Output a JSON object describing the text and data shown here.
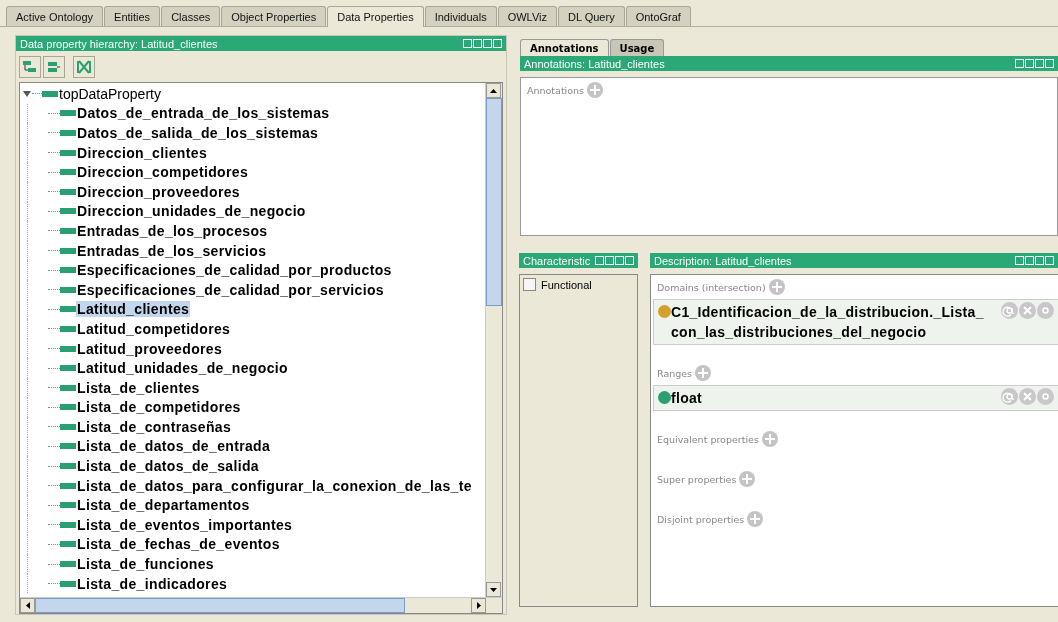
{
  "tabs": [
    {
      "label": "Active Ontology",
      "selected": false
    },
    {
      "label": "Entities",
      "selected": false
    },
    {
      "label": "Classes",
      "selected": false
    },
    {
      "label": "Object Properties",
      "selected": false
    },
    {
      "label": "Data Properties",
      "selected": true
    },
    {
      "label": "Individuals",
      "selected": false
    },
    {
      "label": "OWLViz",
      "selected": false
    },
    {
      "label": "DL Query",
      "selected": false
    },
    {
      "label": "OntoGraf",
      "selected": false
    }
  ],
  "hierarchy": {
    "title": "Data property hierarchy: Latitud_clientes",
    "tree": [
      {
        "label": "topDataProperty",
        "expanded": true,
        "selected": false,
        "children": [
          {
            "label": "Datos_de_entrada_de_los_sistemas",
            "selected": false
          },
          {
            "label": "Datos_de_salida_de_los_sistemas",
            "selected": false
          },
          {
            "label": "Direccion_clientes",
            "selected": false
          },
          {
            "label": "Direccion_competidores",
            "selected": false
          },
          {
            "label": "Direccion_proveedores",
            "selected": false
          },
          {
            "label": "Direccion_unidades_de_negocio",
            "selected": false
          },
          {
            "label": "Entradas_de_los_procesos",
            "selected": false
          },
          {
            "label": "Entradas_de_los_servicios",
            "selected": false
          },
          {
            "label": "Especificaciones_de_calidad_por_productos",
            "selected": false
          },
          {
            "label": "Especificaciones_de_calidad_por_servicios",
            "selected": false
          },
          {
            "label": "Latitud_clientes",
            "selected": true
          },
          {
            "label": "Latitud_competidores",
            "selected": false
          },
          {
            "label": "Latitud_proveedores",
            "selected": false
          },
          {
            "label": "Latitud_unidades_de_negocio",
            "selected": false
          },
          {
            "label": "Lista_de_clientes",
            "selected": false
          },
          {
            "label": "Lista_de_competidores",
            "selected": false
          },
          {
            "label": "Lista_de_contraseñas",
            "selected": false
          },
          {
            "label": "Lista_de_datos_de_entrada",
            "selected": false
          },
          {
            "label": "Lista_de_datos_de_salida",
            "selected": false
          },
          {
            "label": "Lista_de_datos_para_configurar_la_conexion_de_las_te",
            "selected": false
          },
          {
            "label": "Lista_de_departamentos",
            "selected": false
          },
          {
            "label": "Lista_de_eventos_importantes",
            "selected": false
          },
          {
            "label": "Lista_de_fechas_de_eventos",
            "selected": false
          },
          {
            "label": "Lista_de_funciones",
            "selected": false
          },
          {
            "label": "Lista_de_indicadores",
            "selected": false
          }
        ]
      }
    ]
  },
  "view_tabs": [
    {
      "label": "Annotations",
      "selected": true
    },
    {
      "label": "Usage",
      "selected": false
    }
  ],
  "annotations": {
    "title": "Annotations: Latitud_clientes",
    "section": "Annotations"
  },
  "characteristics": {
    "title": "Characteristic",
    "items": [
      {
        "label": "Functional",
        "checked": false
      }
    ]
  },
  "description": {
    "title": "Description: Latitud_clientes",
    "sections": [
      {
        "label": "Domains (intersection)",
        "items": [
          {
            "text": "C1_Identificacion_de_la_distribucion._Lista_ con_las_distribuciones_del_negocio",
            "color": "#d4a02c"
          }
        ]
      },
      {
        "label": "Ranges",
        "items": [
          {
            "text": "float",
            "color": "#2aa072"
          }
        ]
      },
      {
        "label": "Equivalent properties"
      },
      {
        "label": "Super properties"
      },
      {
        "label": "Disjoint properties"
      }
    ]
  }
}
